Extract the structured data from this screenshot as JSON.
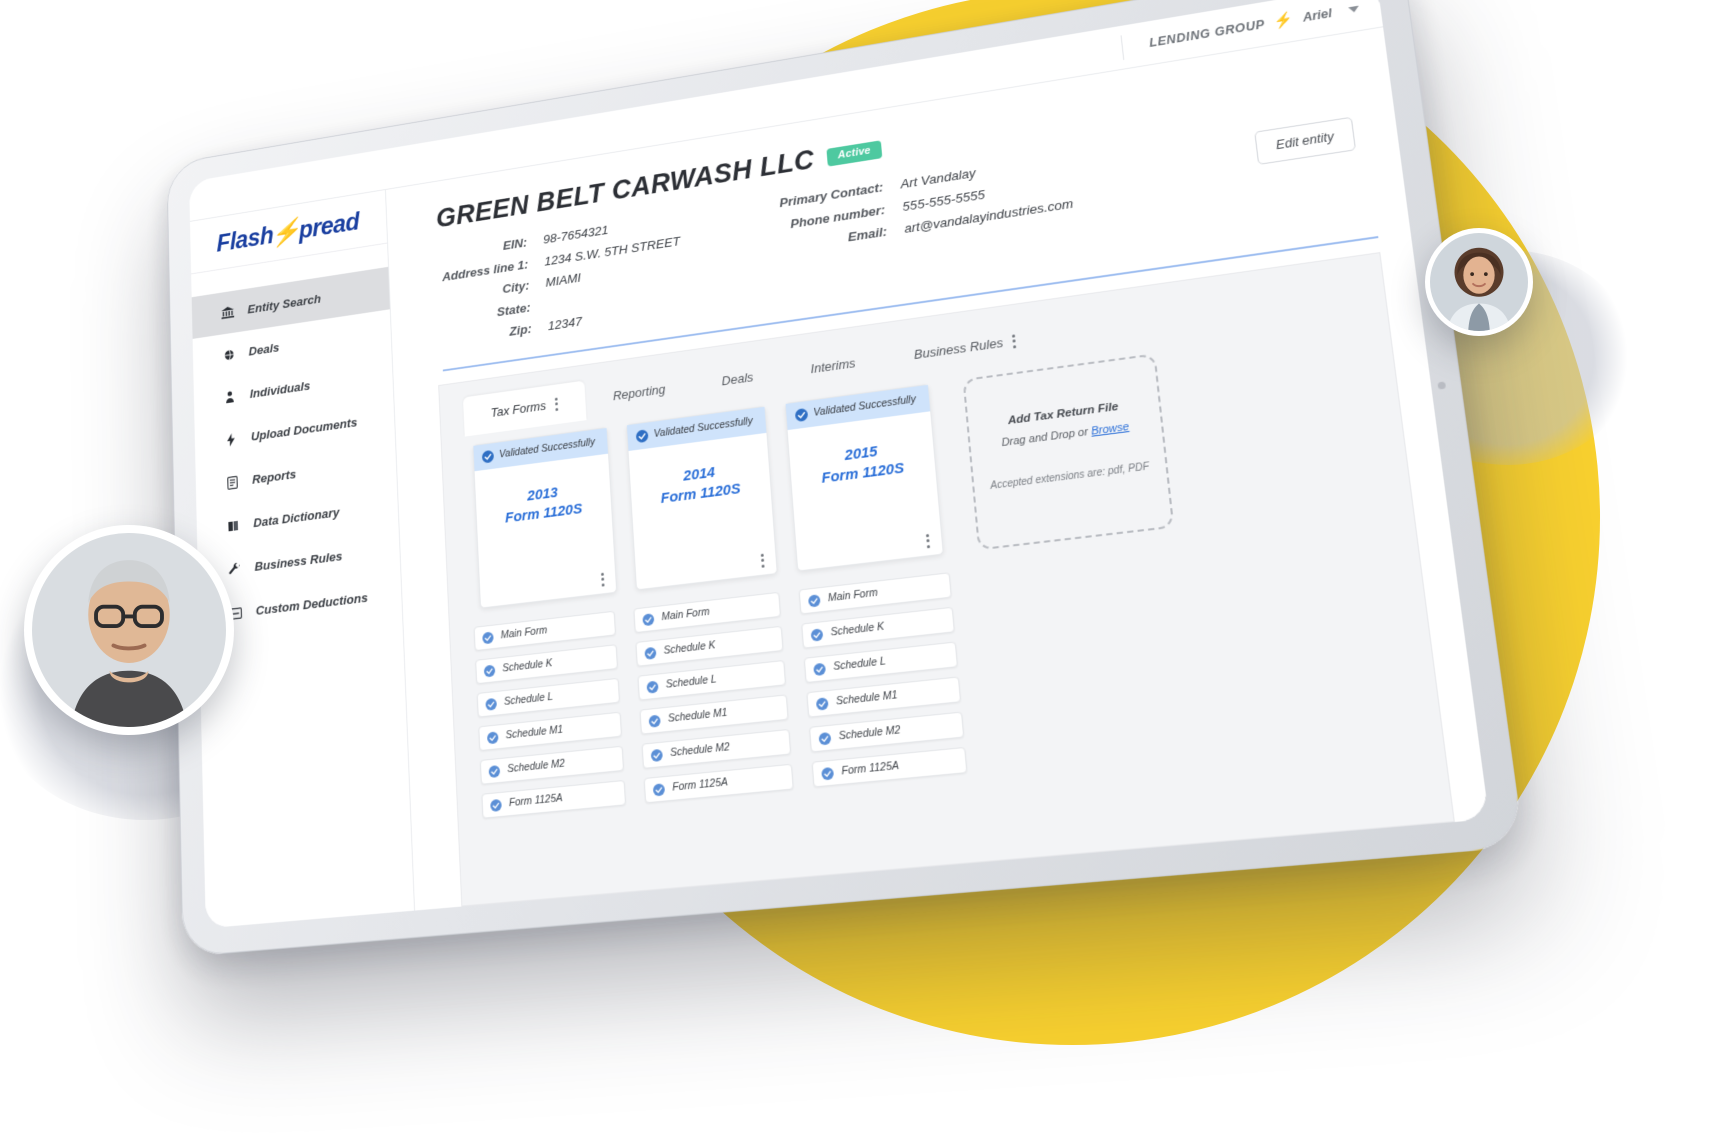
{
  "topbar": {
    "lending_group_label": "LENDING GROUP",
    "bolt_icon": "bolt-icon",
    "user_name": "Ariel"
  },
  "sidebar": {
    "logo_left": "Flash",
    "logo_bolt": "⚡",
    "logo_right": "pread",
    "items": [
      {
        "label": "Entity Search",
        "icon": "bank-icon",
        "active": true
      },
      {
        "label": "Deals",
        "icon": "globe-icon",
        "active": false
      },
      {
        "label": "Individuals",
        "icon": "person-icon",
        "active": false
      },
      {
        "label": "Upload Documents",
        "icon": "bolt-icon",
        "active": false
      },
      {
        "label": "Reports",
        "icon": "report-icon",
        "active": false
      },
      {
        "label": "Data Dictionary",
        "icon": "book-icon",
        "active": false
      },
      {
        "label": "Business Rules",
        "icon": "wrench-icon",
        "active": false
      },
      {
        "label": "Custom Deductions",
        "icon": "deduction-icon",
        "active": false
      }
    ]
  },
  "entity": {
    "title": "GREEN BELT CARWASH LLC",
    "status_badge": "Active",
    "edit_button": "Edit entity",
    "left_fields": [
      {
        "label": "EIN:",
        "value": "98-7654321"
      },
      {
        "label": "Address line 1:",
        "value": "1234 S.W. 5TH STREET"
      },
      {
        "label": "City:",
        "value": "MIAMI"
      },
      {
        "label": "State:",
        "value": ""
      },
      {
        "label": "Zip:",
        "value": "12347"
      }
    ],
    "right_fields": [
      {
        "label": "Primary Contact:",
        "value": "Art Vandalay"
      },
      {
        "label": "Phone number:",
        "value": "555-555-5555"
      },
      {
        "label": "Email:",
        "value": "art@vandalayindustries.com"
      }
    ]
  },
  "tabs": [
    {
      "label": "Tax Forms",
      "active": true,
      "kebab": true
    },
    {
      "label": "Reporting",
      "active": false,
      "kebab": false
    },
    {
      "label": "Deals",
      "active": false,
      "kebab": false
    },
    {
      "label": "Interims",
      "active": false,
      "kebab": false
    },
    {
      "label": "Business Rules",
      "active": false,
      "kebab": true
    }
  ],
  "tax_forms": {
    "cards": [
      {
        "status": "Validated Successfully",
        "year": "2013",
        "form": "Form 1120S"
      },
      {
        "status": "Validated Successfully",
        "year": "2014",
        "form": "Form 1120S"
      },
      {
        "status": "Validated Successfully",
        "year": "2015",
        "form": "Form 1120S"
      }
    ],
    "dropzone": {
      "title": "Add Tax Return File",
      "subtitle_prefix": "Drag and Drop or ",
      "browse_label": "Browse",
      "extensions": "Accepted extensions are: pdf, PDF"
    },
    "schedule_columns": [
      [
        "Main Form",
        "Schedule K",
        "Schedule L",
        "Schedule M1",
        "Schedule M2",
        "Form 1125A"
      ],
      [
        "Main Form",
        "Schedule K",
        "Schedule L",
        "Schedule M1",
        "Schedule M2",
        "Form 1125A"
      ],
      [
        "Main Form",
        "Schedule K",
        "Schedule L",
        "Schedule M1",
        "Schedule M2",
        "Form 1125A"
      ]
    ]
  },
  "colors": {
    "brand_blue": "#1a3fa0",
    "accent_yellow": "#F9D12E",
    "link_blue": "#2b6fd8",
    "status_green": "#4EC9A0",
    "card_status_bg": "#cfe3fb"
  }
}
